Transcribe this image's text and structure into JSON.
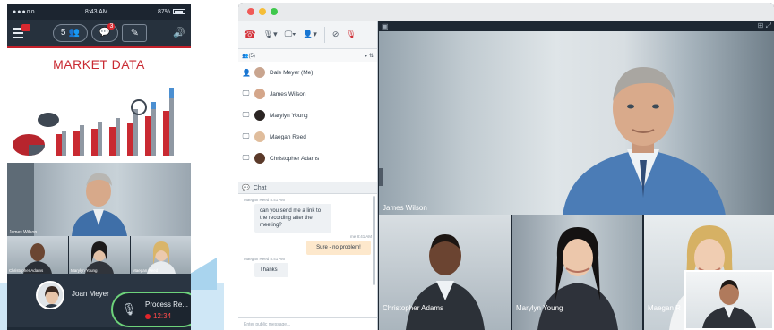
{
  "phone": {
    "status": {
      "signal": "●●●oo",
      "wifi": "wifi-icon",
      "time": "8:43 AM",
      "battery": "87%"
    },
    "toolbar": {
      "participants_count": "5",
      "chat_badge": "3"
    },
    "market_title": "MARKET DATA",
    "main_video_label": "James Wilson",
    "thumbs": [
      {
        "label": "Christopher Adams"
      },
      {
        "label": "Marylyn Young"
      },
      {
        "label": "Maegan Reed"
      }
    ],
    "caller_name": "Joan Meyer",
    "record": {
      "label": "Process Re...",
      "time": "12:34"
    }
  },
  "desktop": {
    "toolbar": {
      "end_call": "☎",
      "audio": "🎙▾",
      "video": "🖵▾",
      "users": "👤▾"
    },
    "participants_header": "(5)",
    "participants": [
      {
        "name": "Dale Meyer (Me)",
        "device": "👤"
      },
      {
        "name": "James Wilson",
        "device": "🖵"
      },
      {
        "name": "Marylyn Young",
        "device": "🖵"
      },
      {
        "name": "Maegan Reed",
        "device": "🖵"
      },
      {
        "name": "Christopher Adams",
        "device": "🖵"
      }
    ],
    "chat": {
      "title": "Chat",
      "messages": [
        {
          "meta": "Maegan Reed 8:41 AM",
          "text": "can you send me a link to the recording after the meeting?",
          "me": false
        },
        {
          "meta": "me 8:41 AM",
          "text": "Sure - no problem!",
          "me": true
        },
        {
          "meta": "Maegan Reed 8:41 AM",
          "text": "Thanks",
          "me": false
        }
      ],
      "input_placeholder": "Enter public message..."
    },
    "main_video_label": "James Wilson",
    "thumbs": [
      {
        "label": "Christopher Adams"
      },
      {
        "label": "Marylyn Young"
      },
      {
        "label": "Maegan R"
      }
    ]
  },
  "colors": {
    "brand_red": "#c92a32",
    "recording_green": "#6dd27a",
    "dark_panel": "#1e2833"
  }
}
